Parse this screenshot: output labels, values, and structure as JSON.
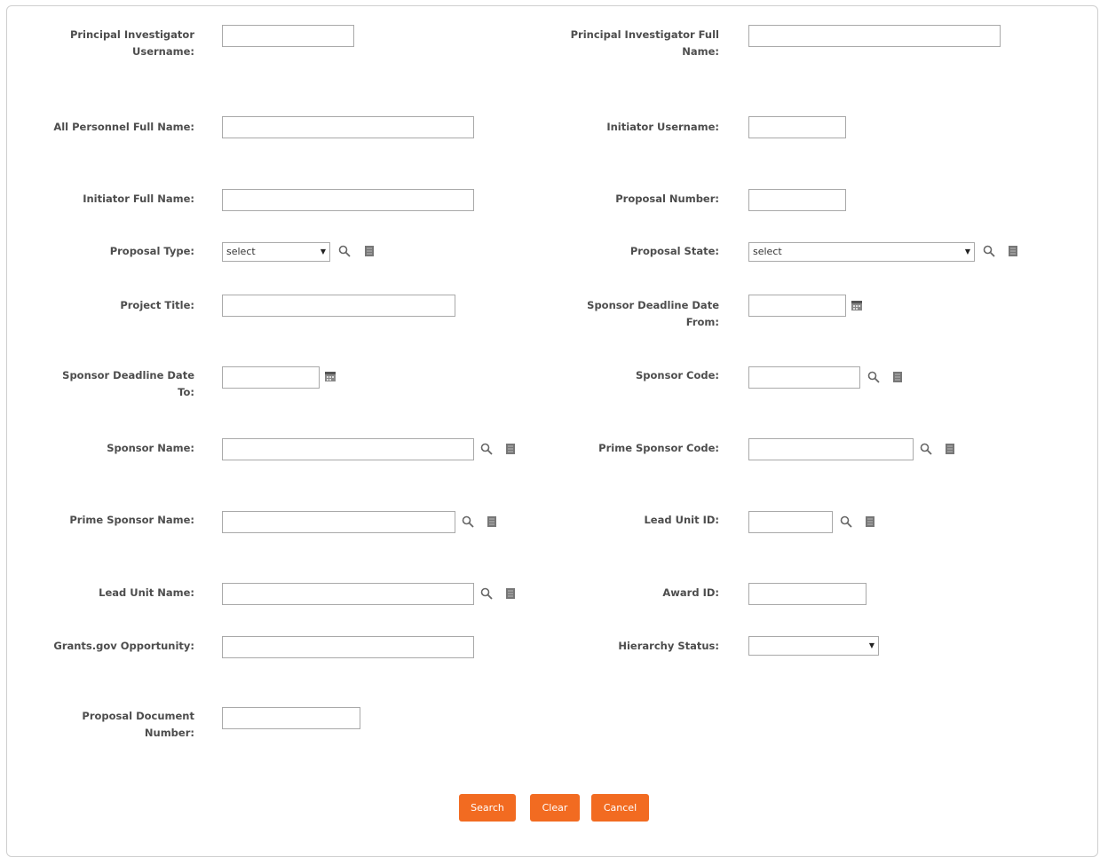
{
  "fields": {
    "pi_username": "Principal Investigator Username:",
    "pi_full_name": "Principal Investigator Full Name:",
    "all_personnel": "All Personnel Full Name:",
    "initiator_username": "Initiator Username:",
    "initiator_full_name": "Initiator Full Name:",
    "proposal_number": "Proposal Number:",
    "proposal_type": "Proposal Type:",
    "proposal_state": "Proposal State:",
    "project_title": "Project Title:",
    "sponsor_deadline_from": "Sponsor Deadline Date From:",
    "sponsor_deadline_to": "Sponsor Deadline Date To:",
    "sponsor_code": "Sponsor Code:",
    "sponsor_name": "Sponsor Name:",
    "prime_sponsor_code": "Prime Sponsor Code:",
    "prime_sponsor_name": "Prime Sponsor Name:",
    "lead_unit_id": "Lead Unit ID:",
    "lead_unit_name": "Lead Unit Name:",
    "award_id": "Award ID:",
    "grants_gov": "Grants.gov Opportunity:",
    "hierarchy_status": "Hierarchy Status:",
    "proposal_doc_number": "Proposal Document Number:"
  },
  "selects": {
    "proposal_type_value": "select",
    "proposal_state_value": "select",
    "hierarchy_status_value": ""
  },
  "icons": {
    "lookup": "search-icon",
    "direct_inquiry": "document-icon",
    "calendar": "calendar-icon"
  },
  "buttons": {
    "search": "Search",
    "clear": "Clear",
    "cancel": "Cancel"
  },
  "colors": {
    "button_bg": "#f26b21",
    "label_text": "#4d4d4d",
    "input_border": "#a9a9a9"
  }
}
